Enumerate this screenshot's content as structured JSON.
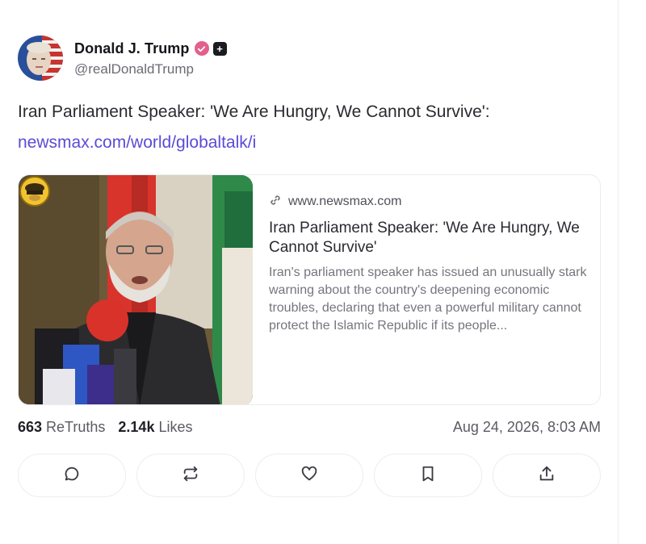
{
  "post": {
    "author": {
      "display_name": "Donald J. Trump",
      "handle": "@realDonaldTrump",
      "verified_icon": "verified-check-icon",
      "badge_icon": "plus-badge-icon",
      "badge_text": "+"
    },
    "text": "Iran Parliament Speaker: 'We Are Hungry, We Cannot Survive':",
    "link": "newsmax.com/world/globaltalk/i",
    "link_card": {
      "domain_icon": "link-icon",
      "domain": "www.newsmax.com",
      "title": "Iran Parliament Speaker: 'We Are Hungry, We Cannot Survive'",
      "description": "Iran's parliament speaker has issued an unusually stark warning about the country's deepening economic troubles, declaring that even a powerful military cannot protect the Islamic Republic if its people..."
    },
    "stats": {
      "retruths_count": "663",
      "retruths_label": "ReTruths",
      "likes_count": "2.14k",
      "likes_label": "Likes",
      "timestamp": "Aug 24, 2026, 8:03 AM"
    },
    "actions": [
      {
        "name": "reply",
        "icon": "comment-icon"
      },
      {
        "name": "retruth",
        "icon": "repost-icon"
      },
      {
        "name": "like",
        "icon": "heart-icon"
      },
      {
        "name": "bookmark",
        "icon": "bookmark-icon"
      },
      {
        "name": "share",
        "icon": "share-icon"
      }
    ]
  },
  "colors": {
    "link": "#5b4bd6",
    "verified": "#e35f8c",
    "text": "#2a2a30",
    "muted": "#75757e",
    "border": "#ececf0"
  }
}
